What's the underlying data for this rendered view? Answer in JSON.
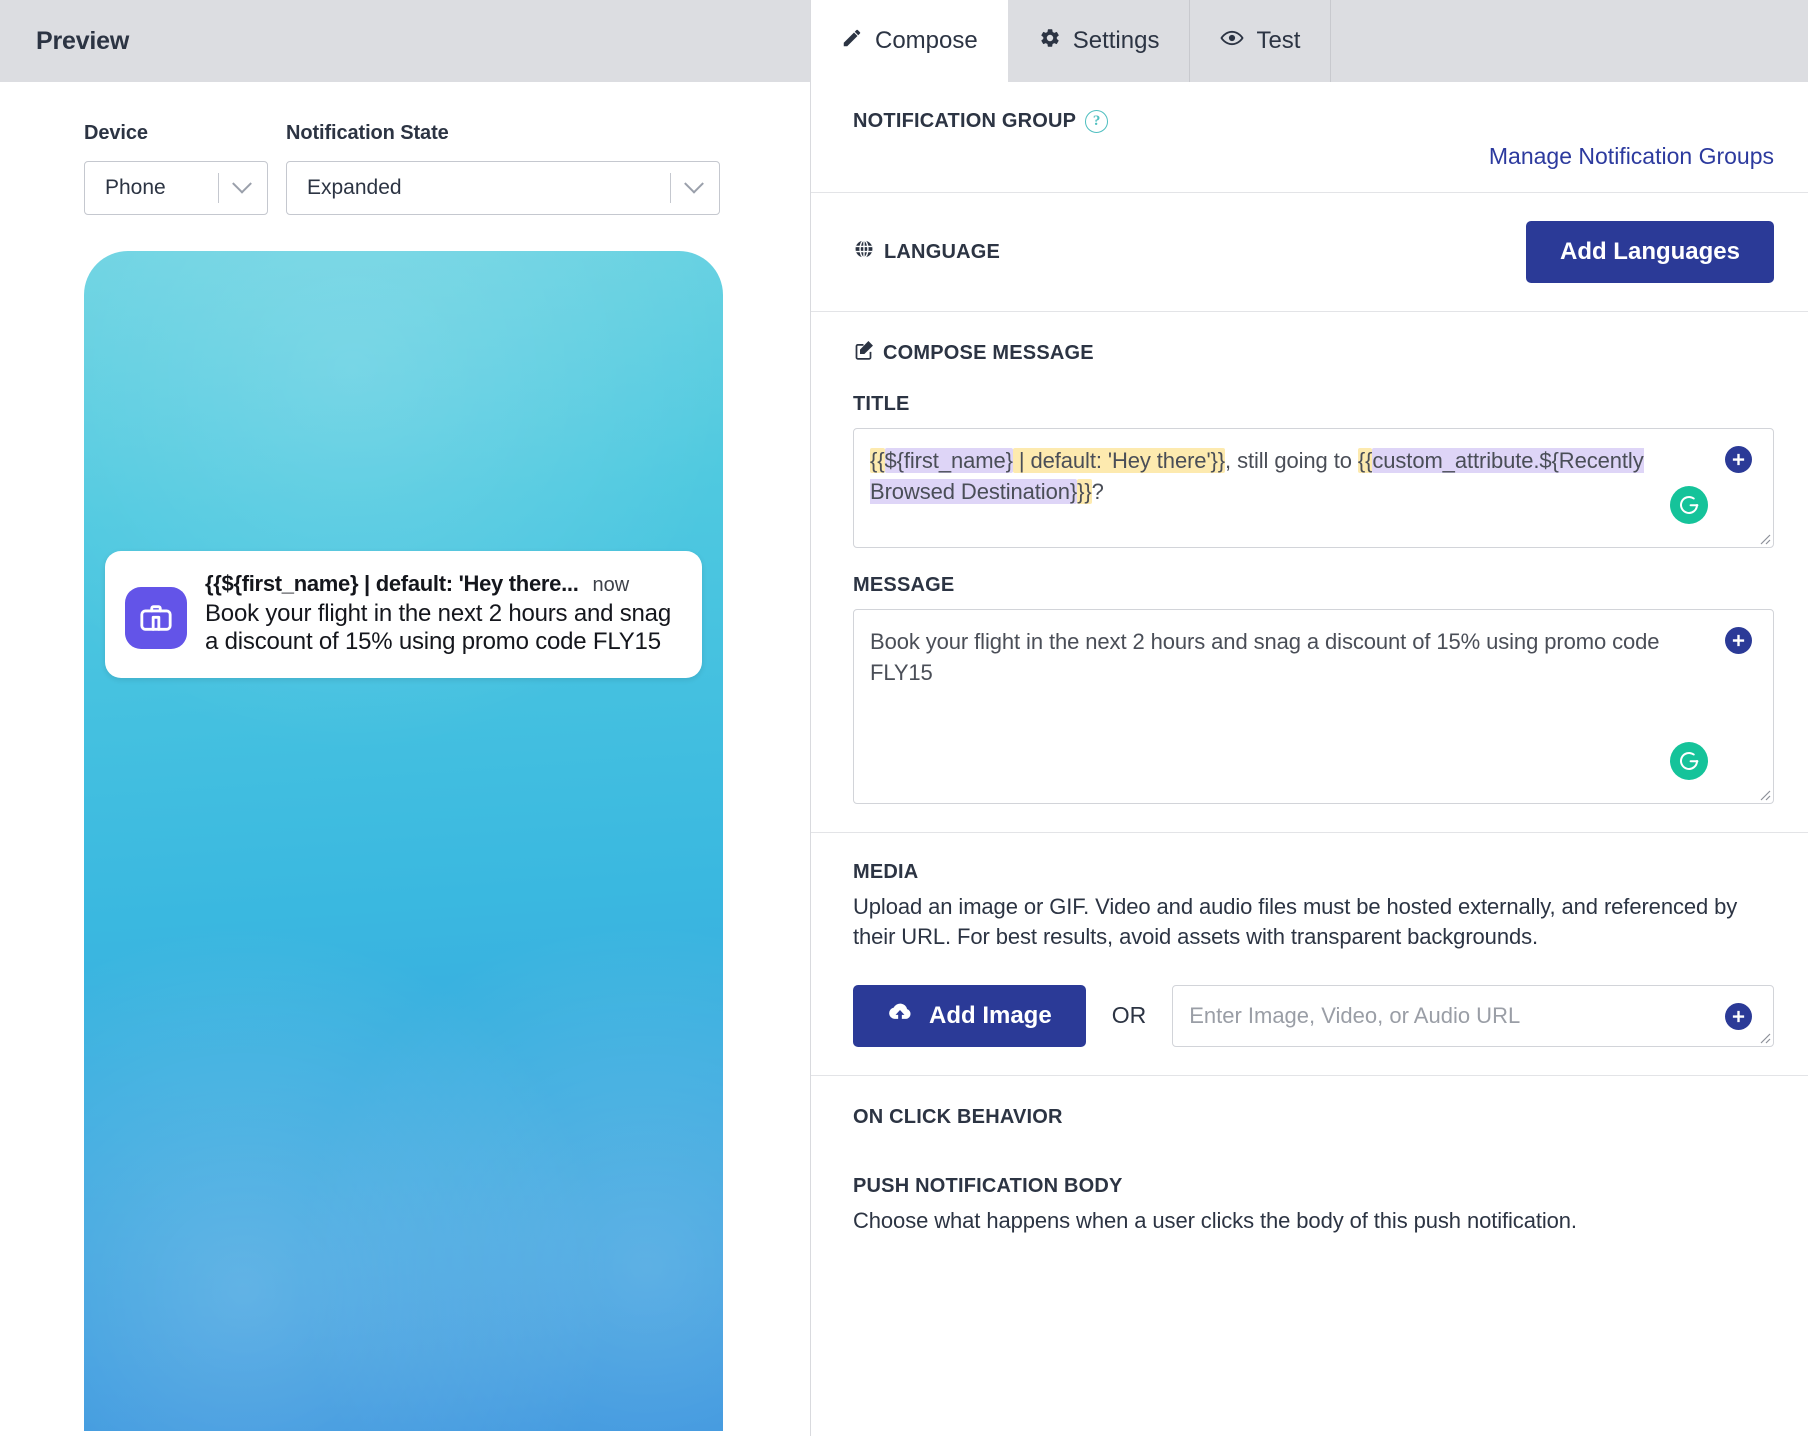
{
  "preview": {
    "header_title": "Preview",
    "device": {
      "label": "Device",
      "value": "Phone"
    },
    "notification_state": {
      "label": "Notification State",
      "value": "Expanded"
    },
    "notification": {
      "title": "{{${first_name} | default: 'Hey there...",
      "time": "now",
      "body": "Book your flight in the next 2 hours and snag a discount of 15% using promo code FLY15",
      "app_icon": "briefcase-icon"
    }
  },
  "tabs": [
    {
      "label": "Compose",
      "icon": "pencil-icon",
      "active": true
    },
    {
      "label": "Settings",
      "icon": "gear-icon",
      "active": false
    },
    {
      "label": "Test",
      "icon": "eye-icon",
      "active": false
    }
  ],
  "notification_group": {
    "heading": "NOTIFICATION GROUP",
    "help_icon": "question-mark-icon",
    "manage_link": "Manage Notification Groups"
  },
  "language": {
    "heading": "LANGUAGE",
    "icon": "globe-icon",
    "add_button": "Add Languages"
  },
  "compose": {
    "heading": "COMPOSE MESSAGE",
    "icon": "compose-pencil-icon",
    "title_label": "TITLE",
    "title_segments": [
      {
        "text": "{{",
        "style": "yellow"
      },
      {
        "text": "${first_name}",
        "style": "purple"
      },
      {
        "text": " | default: 'Hey there'}}",
        "style": "yellow"
      },
      {
        "text": ", still going to ",
        "style": "none"
      },
      {
        "text": "{{",
        "style": "yellow"
      },
      {
        "text": "custom_attribute.${Recently Browsed Destination}",
        "style": "purple"
      },
      {
        "text": "}}",
        "style": "yellow"
      },
      {
        "text": "?",
        "style": "none"
      }
    ],
    "title_value": "{{${first_name} | default: 'Hey there'}}, still going to {{custom_attribute.${Recently Browsed Destination}}}?",
    "message_label": "MESSAGE",
    "message_value": "Book your flight in the next 2 hours and snag a discount of 15% using promo code FLY15",
    "add_icon": "plus-circle-icon",
    "grammarly_icon": "grammarly-icon",
    "resize_icon": "resize-handle-icon"
  },
  "media": {
    "heading": "MEDIA",
    "description": "Upload an image or GIF. Video and audio files must be hosted externally, and referenced by their URL. For best results, avoid assets with transparent backgrounds.",
    "add_image_button": "Add Image",
    "upload_icon": "cloud-upload-icon",
    "or_text": "OR",
    "url_placeholder": "Enter Image, Video, or Audio URL",
    "url_value": ""
  },
  "on_click": {
    "heading": "ON CLICK BEHAVIOR",
    "push_body_label": "PUSH NOTIFICATION BODY",
    "push_body_desc": "Choose what happens when a user clicks the body of this push notification."
  },
  "colors": {
    "brand_blue": "#2b3a97",
    "link_blue": "#2c3a9e",
    "grammarly_green": "#15c39a",
    "teal_help": "#4fbfc0",
    "highlight_yellow": "#fdeaaf",
    "highlight_purple": "#ded5f7",
    "app_icon_purple": "#6354e8",
    "header_grey": "#dcdde1"
  }
}
